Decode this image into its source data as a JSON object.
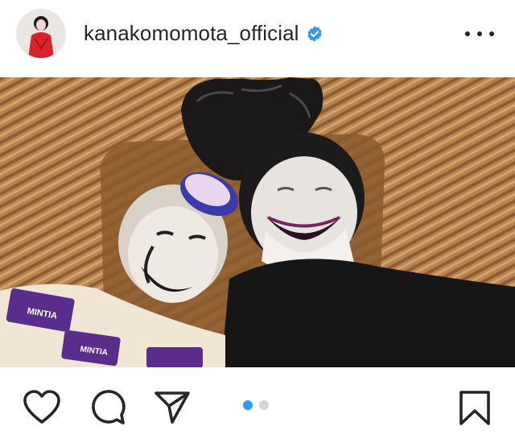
{
  "post": {
    "username": "kanakomomota_official",
    "verified": true,
    "avatar_icon": "profile-avatar",
    "more_icon": "more-options-icon"
  },
  "photo": {
    "description_icon": "post-photo"
  },
  "actions": {
    "like_icon": "heart-icon",
    "comment_icon": "comment-icon",
    "share_icon": "send-icon",
    "save_icon": "bookmark-icon"
  },
  "carousel": {
    "current": 1,
    "total": 2
  },
  "colors": {
    "accent": "#2a9df4",
    "text": "#262626",
    "verified": "#3897f0"
  }
}
